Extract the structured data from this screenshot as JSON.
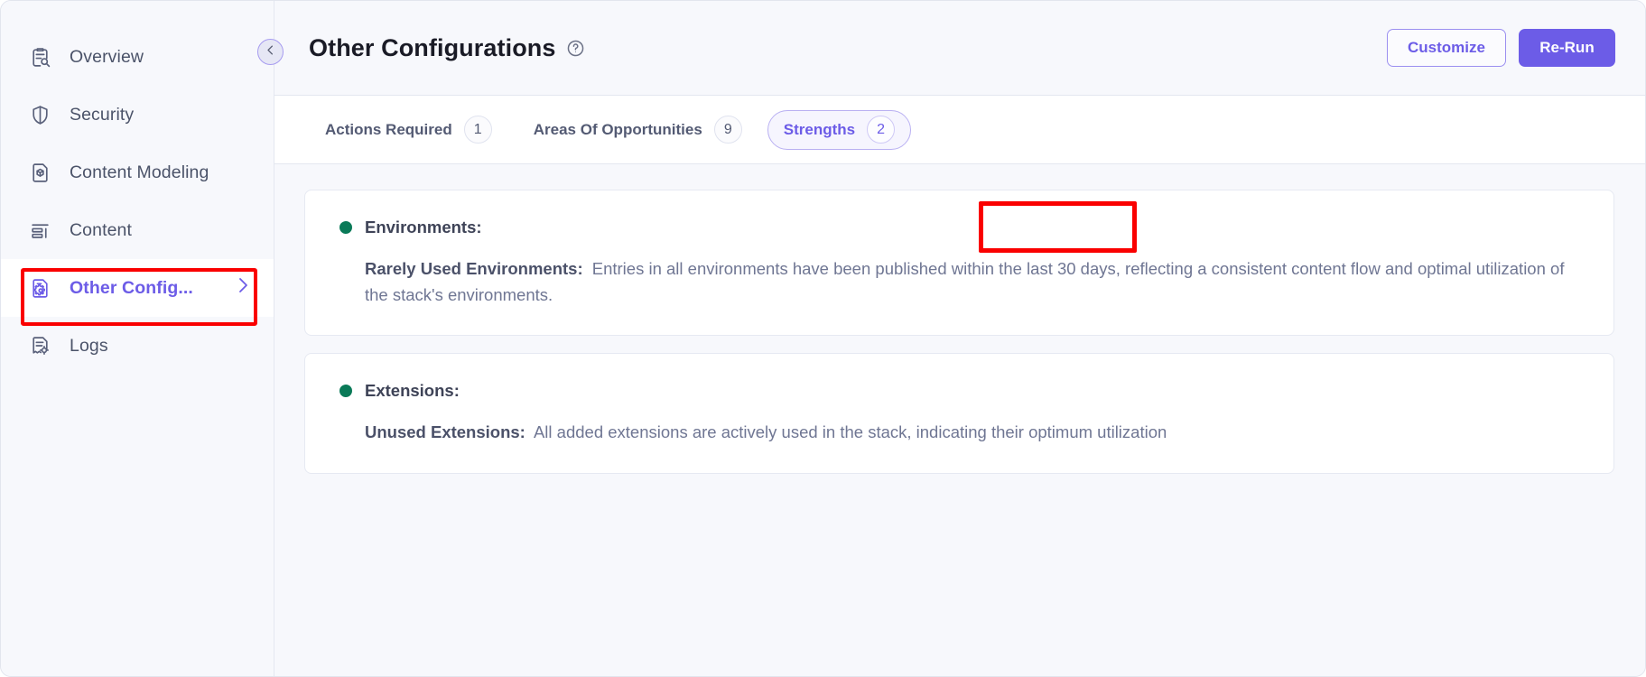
{
  "sidebar": {
    "items": [
      {
        "label": "Overview",
        "icon": "clipboard-search-icon",
        "active": false
      },
      {
        "label": "Security",
        "icon": "shield-icon",
        "active": false
      },
      {
        "label": "Content Modeling",
        "icon": "document-cube-icon",
        "active": false
      },
      {
        "label": "Content",
        "icon": "content-list-icon",
        "active": false
      },
      {
        "label": "Other Config...",
        "icon": "document-gear-icon",
        "active": true
      },
      {
        "label": "Logs",
        "icon": "logs-receipt-icon",
        "active": false
      }
    ]
  },
  "header": {
    "title": "Other Configurations",
    "help_icon": "question-circle-icon",
    "collapse_icon": "chevron-left-icon",
    "customize_label": "Customize",
    "rerun_label": "Re-Run"
  },
  "tabs": [
    {
      "label": "Actions Required",
      "count": "1",
      "active": false
    },
    {
      "label": "Areas Of Opportunities",
      "count": "9",
      "active": false
    },
    {
      "label": "Strengths",
      "count": "2",
      "active": true
    }
  ],
  "cards": [
    {
      "title": "Environments:",
      "status_color": "#0a7a58",
      "lead": "Rarely Used Environments:",
      "text": "Entries in all environments have been published within the last 30 days, reflecting a consistent content flow and optimal utilization of the stack's environments."
    },
    {
      "title": "Extensions:",
      "status_color": "#0a7a58",
      "lead": "Unused Extensions:",
      "text": "All added extensions are actively used in the stack, indicating their optimum utilization"
    }
  ],
  "annotations": {
    "sidebar_highlight_color": "#fa0000",
    "tab_highlight_color": "#fa0000"
  },
  "theme": {
    "accent": "#6c5ce7",
    "background": "#f7f8fc",
    "card_background": "#ffffff"
  }
}
